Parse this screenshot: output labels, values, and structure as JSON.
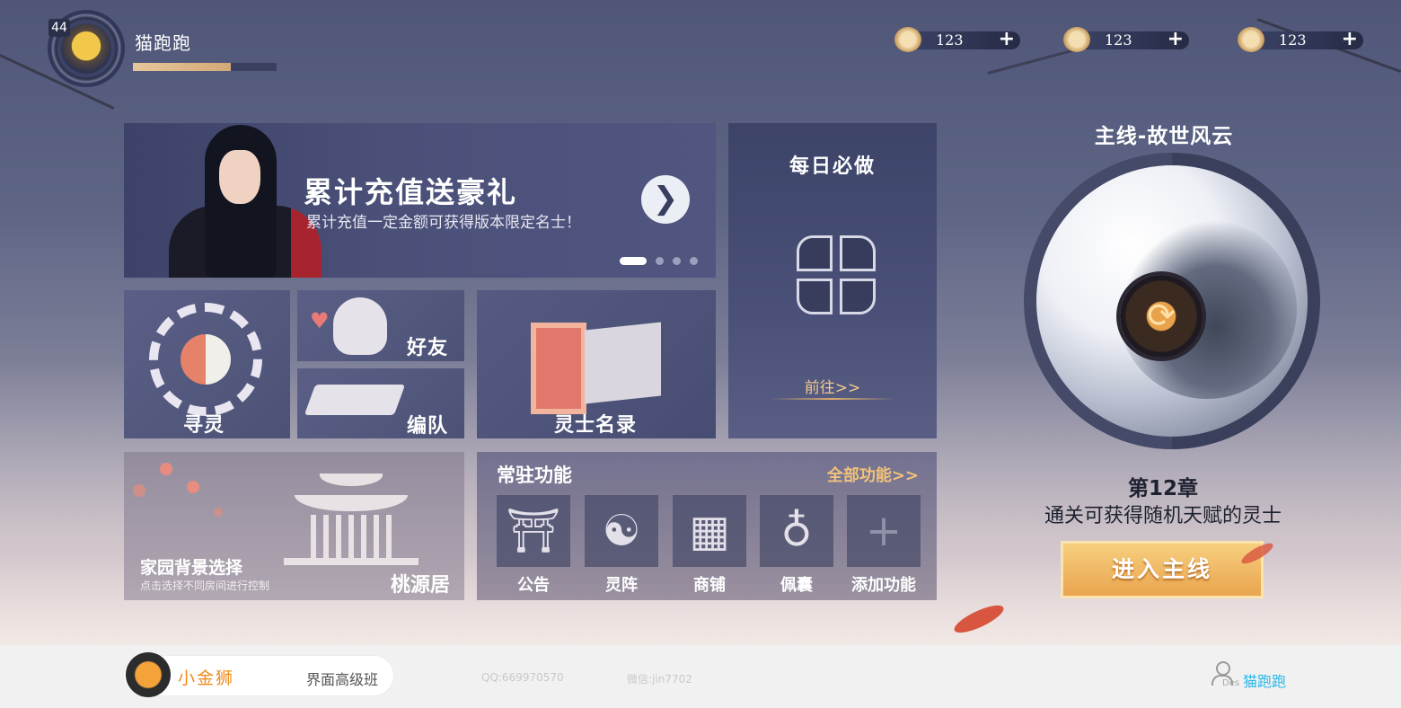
{
  "player": {
    "level": "44",
    "name": "猫跑跑",
    "exp_progress": 0.68
  },
  "resources": [
    {
      "icon": "copper-coin-icon",
      "value": "123",
      "add": "+"
    },
    {
      "icon": "gold-ingot-icon",
      "value": "123",
      "add": "+"
    },
    {
      "icon": "silver-ingot-icon",
      "value": "123",
      "add": "+"
    }
  ],
  "banner": {
    "title": "累计充值送豪礼",
    "subtitle": "累计充值一定金额可获得版本限定名士！",
    "arrow": "❯",
    "page_count": 4,
    "active_page": 1
  },
  "daily": {
    "title": "每日必做",
    "goto": "前往>>"
  },
  "tiles": {
    "seek": "寻灵",
    "friends": "好友",
    "team": "编队",
    "roster": "灵士名录"
  },
  "home": {
    "title": "家园背景选择",
    "hint": "点击选择不同房间进行控制",
    "location": "桃源居"
  },
  "permanent": {
    "title": "常驻功能",
    "all": "全部功能>>",
    "items": [
      {
        "label": "公告",
        "icon": "gate-icon",
        "glyph": "⛩"
      },
      {
        "label": "灵阵",
        "icon": "yin-yang-icon",
        "glyph": "☯"
      },
      {
        "label": "商铺",
        "icon": "abacus-icon",
        "glyph": "▦"
      },
      {
        "label": "佩囊",
        "icon": "pouch-icon",
        "glyph": "♁"
      },
      {
        "label": "添加功能",
        "icon": "add-icon",
        "glyph": "+"
      }
    ]
  },
  "mainline": {
    "title": "主线-故世风云",
    "refresh": "⟳",
    "chapter": "第12章",
    "reward": "通关可获得随机天赋的灵士",
    "enter": "进入主线"
  },
  "footer": {
    "brand": "小金狮",
    "course": "界面高级班",
    "qq": "QQ:669970570",
    "wechat": "微信:jin7702",
    "des": "Des",
    "user": "猫跑跑"
  },
  "colors": {
    "accent_gold": "#f0c98f",
    "enter_button": "#e9a44f",
    "footer_user": "#29b6e8",
    "brand_orange": "#f08a1a"
  }
}
